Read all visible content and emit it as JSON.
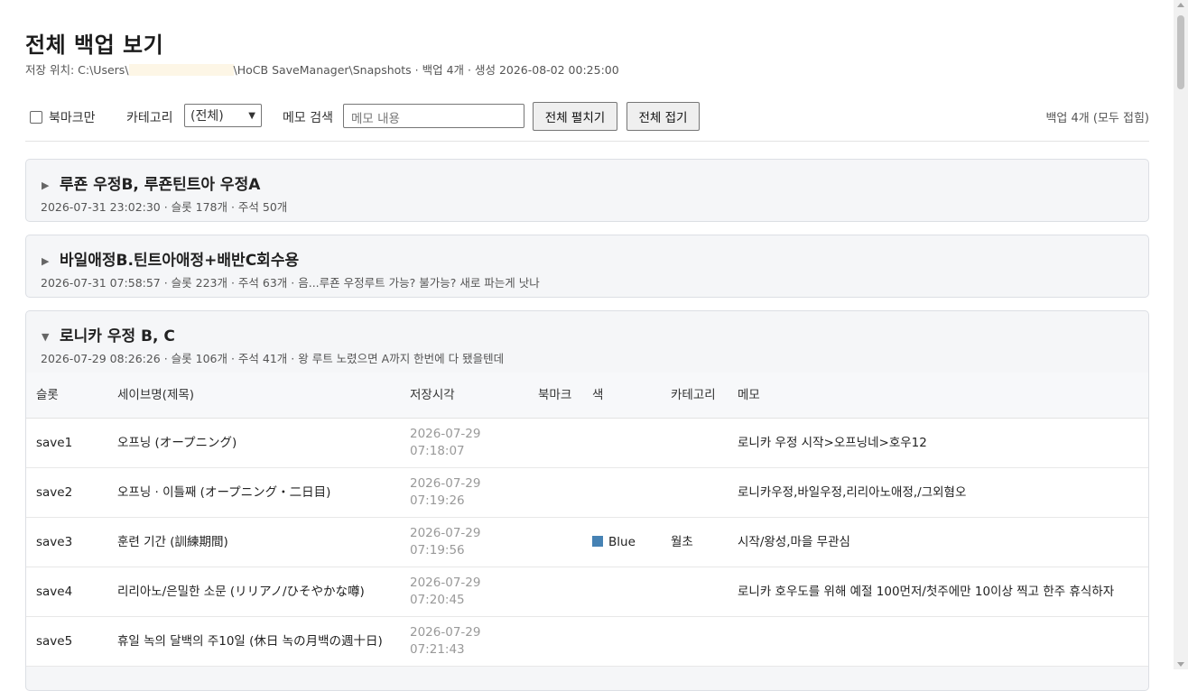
{
  "header": {
    "title": "전체 백업 보기",
    "subtitle_prefix": "저장 위치: C:\\Users\\",
    "subtitle_suffix": "\\HoCB SaveManager\\Snapshots · 백업 4개 · 생성 2026-08-02 00:25:00"
  },
  "toolbar": {
    "bookmark_only_label": "북마크만",
    "category_label": "카테고리",
    "category_selected": "(전체)",
    "memo_search_label": "메모 검색",
    "memo_search_placeholder": "메모 내용",
    "expand_all_label": "전체 펼치기",
    "collapse_all_label": "전체 접기",
    "count_text": "백업 4개 (모두 접힘)"
  },
  "backups": [
    {
      "title": "루죤 우정B, 루죤틴트아 우정A",
      "meta": "2026-07-31 23:02:30 · 슬롯 178개 · 주석 50개",
      "expanded": false
    },
    {
      "title": "바일애정B.틴트아애정+배반C회수용",
      "meta": "2026-07-31 07:58:57 · 슬롯 223개 · 주석 63개 · 음...루죤 우정루트 가능? 불가능? 새로 파는게 낫나",
      "expanded": false
    },
    {
      "title": "로니카 우정 B, C",
      "meta": "2026-07-29 08:26:26 · 슬롯 106개 · 주석 41개 · 왕 루트 노렸으면 A까지 한번에 다 됐을텐데",
      "expanded": true,
      "columns": [
        "슬롯",
        "세이브명(제목)",
        "저장시각",
        "북마크",
        "색",
        "카테고리",
        "메모"
      ],
      "rows": [
        {
          "slot": "save1",
          "name": "오프닝 (オープニング)",
          "time": "2026-07-29 07:18:07",
          "bookmark": "",
          "color": "",
          "category": "",
          "memo": "로니카 우정 시작>오프닝네>호우12"
        },
        {
          "slot": "save2",
          "name": "오프닝 · 이틀째 (オープニング・二日目)",
          "time": "2026-07-29 07:19:26",
          "bookmark": "",
          "color": "",
          "category": "",
          "memo": "로니카우정,바일우정,리리아노애정,/그외혐오"
        },
        {
          "slot": "save3",
          "name": "훈련 기간 (訓練期間)",
          "time": "2026-07-29 07:19:56",
          "bookmark": "",
          "color": "Blue",
          "color_hex": "#4682b4",
          "category": "월초",
          "memo": "시작/왕성,마을 무관심"
        },
        {
          "slot": "save4",
          "name": "리리아노/은밀한 소문 (リリアノ/ひそやかな噂)",
          "time": "2026-07-29 07:20:45",
          "bookmark": "",
          "color": "",
          "category": "",
          "memo": "로니카 호우도를 위해 예절 100먼저/첫주에만 10이상 찍고 한주 휴식하자"
        },
        {
          "slot": "save5",
          "name": "휴일 녹의 달백의 주10일 (休日 녹の月백の週十日)",
          "time": "2026-07-29 07:21:43",
          "bookmark": "",
          "color": "",
          "category": "",
          "memo": ""
        }
      ]
    }
  ]
}
